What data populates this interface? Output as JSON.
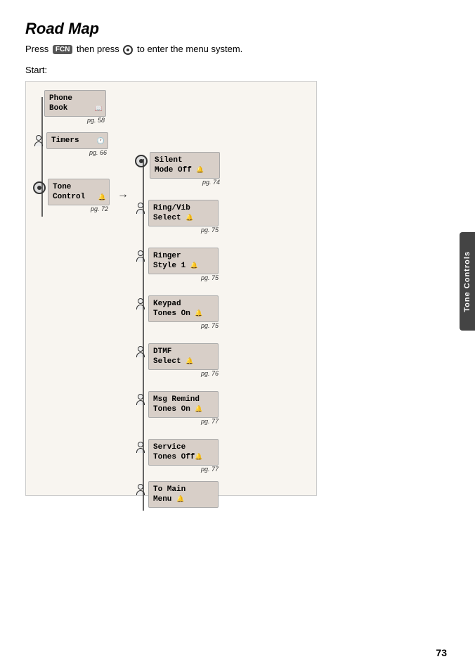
{
  "title": "Road Map",
  "subtitle_before": "Press",
  "fcn_label": "FCN",
  "subtitle_mid": "then press",
  "subtitle_after": "to enter the menu system.",
  "start_label": "Start:",
  "left_items": [
    {
      "id": "phone-book",
      "line1": "Phone",
      "line2": "Book",
      "icon": "book",
      "page_ref": "pg. 58",
      "has_icon_left": false,
      "icon_type": ""
    },
    {
      "id": "timers",
      "line1": "Timers",
      "line2": "",
      "icon": "clock",
      "page_ref": "pg. 66",
      "has_icon_left": true,
      "icon_type": "person"
    },
    {
      "id": "tone-control",
      "line1": "Tone",
      "line2": "Control",
      "icon": "bell",
      "page_ref": "pg. 72",
      "has_icon_left": true,
      "icon_type": "4way"
    }
  ],
  "right_items": [
    {
      "id": "silent-mode",
      "line1": "Silent",
      "line2": "Mode Off",
      "icon": "bell",
      "page_ref": "pg. 74",
      "icon_type": "4way"
    },
    {
      "id": "ring-vib",
      "line1": "Ring/Vib",
      "line2": "Select",
      "icon": "bell",
      "page_ref": "pg. 75",
      "icon_type": "person"
    },
    {
      "id": "ringer-style",
      "line1": "Ringer",
      "line2": "Style 1",
      "icon": "bell",
      "page_ref": "pg. 75",
      "icon_type": "person"
    },
    {
      "id": "keypad-tones",
      "line1": "Keypad",
      "line2": "Tones On",
      "icon": "bell",
      "page_ref": "pg. 75",
      "icon_type": "person"
    },
    {
      "id": "dtmf-select",
      "line1": "DTMF",
      "line2": "Select",
      "icon": "bell",
      "page_ref": "pg. 76",
      "icon_type": "person"
    },
    {
      "id": "msg-remind",
      "line1": "Msg Remind",
      "line2": "Tones On",
      "icon": "bell",
      "page_ref": "pg. 77",
      "icon_type": "person"
    },
    {
      "id": "service-tones",
      "line1": "Service",
      "line2": "Tones Off",
      "icon": "bell",
      "page_ref": "pg. 77",
      "icon_type": "person"
    },
    {
      "id": "to-main-menu",
      "line1": "To Main",
      "line2": "Menu",
      "icon": "bell",
      "page_ref": "",
      "icon_type": "person"
    }
  ],
  "side_tab_label": "Tone Controls",
  "page_number": "73"
}
